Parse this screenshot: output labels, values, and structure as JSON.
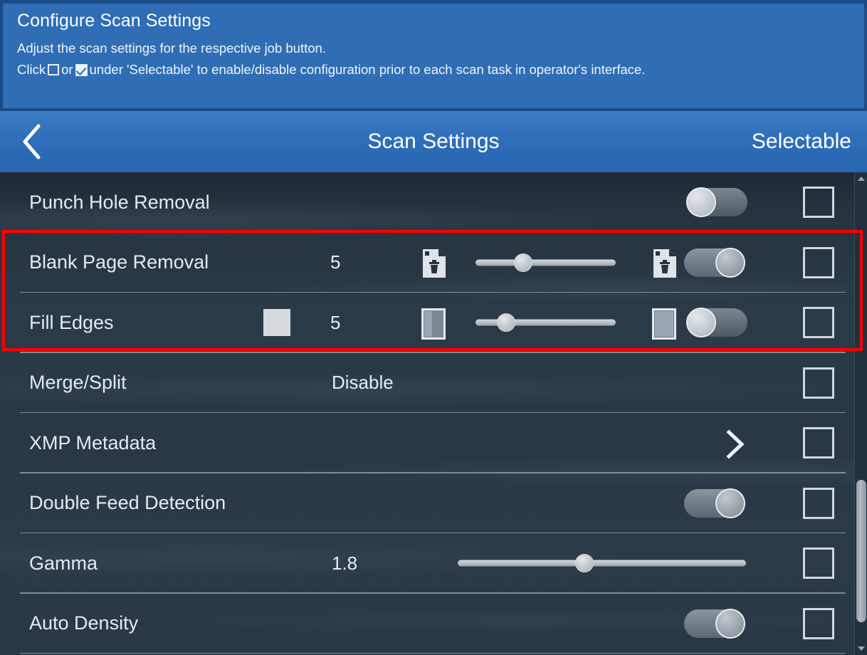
{
  "banner": {
    "title": "Configure Scan Settings",
    "line1": "Adjust the scan settings for the respective job button.",
    "line2_pre": "Click",
    "line2_mid": "or",
    "line2_post": "under 'Selectable' to enable/disable configuration prior to each scan task in operator's interface.",
    "bg_color": "#2f6db5",
    "border_color": "#1b4b86"
  },
  "navbar": {
    "back_icon": "chevron-left-icon",
    "title": "Scan Settings",
    "right_label": "Selectable",
    "bg_color": "#2f6fba"
  },
  "list": {
    "rows": [
      {
        "label": "Punch Hole Removal",
        "value": "",
        "control": "toggle",
        "toggle_state": "off",
        "selectable_checked": false
      },
      {
        "label": "Blank Page Removal",
        "value": "5",
        "control": "slider",
        "slider_percent": 34,
        "icon_left": "page-delete-icon",
        "icon_right": "page-delete-icon",
        "toggle_state": "on",
        "selectable_checked": false
      },
      {
        "label": "Fill Edges",
        "value": "5",
        "control": "slider",
        "slider_percent": 22,
        "swatch": "#d4dade",
        "icon_left": "page-fill-narrow-icon",
        "icon_right": "page-fill-wide-icon",
        "toggle_state": "off",
        "selectable_checked": false
      },
      {
        "label": "Merge/Split",
        "value": "Disable",
        "control": "text",
        "selectable_checked": false
      },
      {
        "label": "XMP Metadata",
        "value": "",
        "control": "chevron",
        "selectable_checked": false
      },
      {
        "label": "Double Feed Detection",
        "value": "",
        "control": "toggle",
        "toggle_state": "on",
        "selectable_checked": false
      },
      {
        "label": "Gamma",
        "value": "1.8",
        "control": "slider",
        "slider_percent": 44,
        "selectable_checked": false
      },
      {
        "label": "Auto Density",
        "value": "",
        "control": "toggle",
        "toggle_state": "on",
        "selectable_checked": false
      }
    ]
  },
  "scrollbar": {
    "up_arrow": "caret-up-icon",
    "down_arrow": "caret-down-icon",
    "thumb_top_percent": 64,
    "thumb_height_percent": 30
  },
  "highlight": {
    "color": "#ff0000",
    "rows": "Blank Page Removal, Fill Edges"
  }
}
